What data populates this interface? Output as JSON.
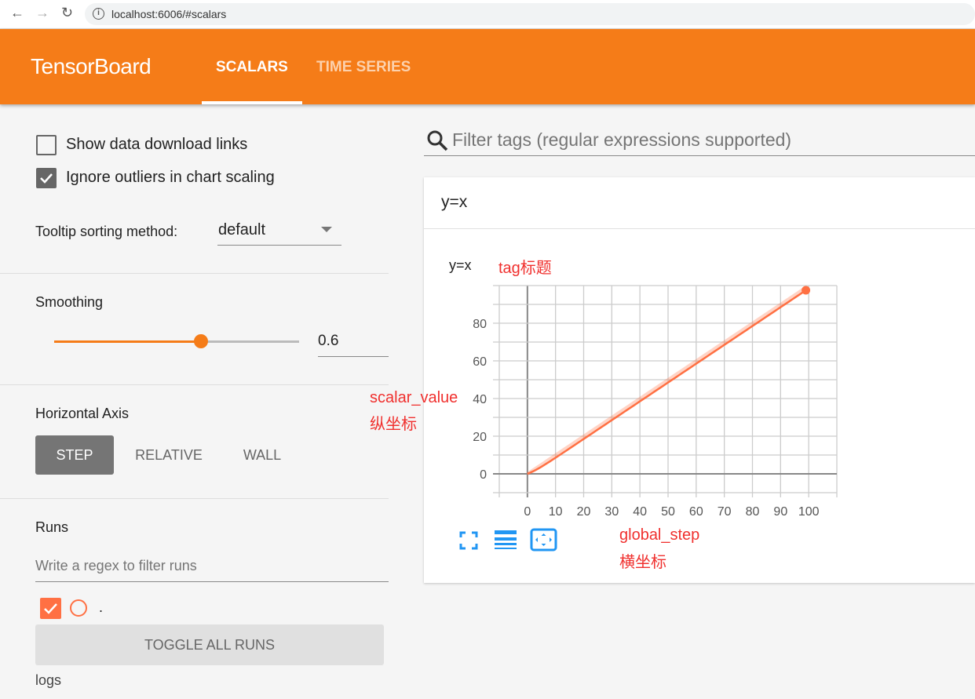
{
  "browser": {
    "url": "localhost:6006/#scalars"
  },
  "header": {
    "title": "TensorBoard",
    "tabs": [
      {
        "label": "SCALARS",
        "active": true
      },
      {
        "label": "TIME SERIES",
        "active": false
      }
    ]
  },
  "sidebar": {
    "show_download": {
      "label": "Show data download links",
      "checked": false
    },
    "ignore_outliers": {
      "label": "Ignore outliers in chart scaling",
      "checked": true
    },
    "tooltip": {
      "label": "Tooltip sorting method:",
      "value": "default"
    },
    "smoothing": {
      "label": "Smoothing",
      "value": "0.6",
      "fraction": 0.6
    },
    "horizontal_axis": {
      "label": "Horizontal Axis",
      "options": [
        "STEP",
        "RELATIVE",
        "WALL"
      ],
      "selected": "STEP"
    },
    "runs": {
      "label": "Runs",
      "placeholder": "Write a regex to filter runs",
      "items": [
        {
          "name": ".",
          "checked": true,
          "color": "#ff7043"
        }
      ],
      "toggle_label": "TOGGLE ALL RUNS",
      "logdir": "logs"
    }
  },
  "main": {
    "filter_placeholder": "Filter tags (regular expressions supported)",
    "card_title": "y=x"
  },
  "annotations": {
    "tag": "tag标题",
    "y1": "scalar_value",
    "y2": "纵坐标",
    "x1": "global_step",
    "x2": "横坐标"
  },
  "colors": {
    "accent": "#f57c18",
    "series": "#ff7043",
    "icons": "#2196f3",
    "annotation": "#f0302e"
  },
  "chart_data": {
    "type": "line",
    "title": "y=x",
    "xlabel": "",
    "ylabel": "",
    "xlim": [
      -10,
      110
    ],
    "ylim": [
      -10,
      100
    ],
    "xticks": [
      0,
      10,
      20,
      30,
      40,
      50,
      60,
      70,
      80,
      90,
      100
    ],
    "yticks": [
      0,
      20,
      40,
      60,
      80
    ],
    "grid": true,
    "smoothing": 0.6,
    "series": [
      {
        "x_start": 0,
        "x_end": 99,
        "relation": "y=x"
      }
    ]
  }
}
